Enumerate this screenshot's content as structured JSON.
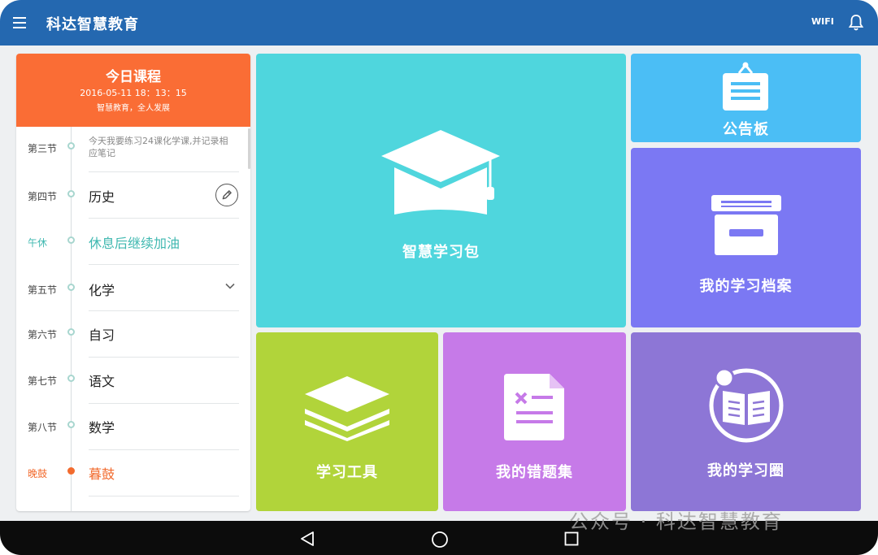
{
  "app": {
    "title": "科达智慧教育",
    "wifi_label": "WIFI"
  },
  "schedule": {
    "header_title": "今日课程",
    "datetime": "2016-05-11 18：13：15",
    "motto": "智慧教育，全人发展",
    "top_note": "今天我要练习24课化学课,并记录相应笔记",
    "rows": [
      {
        "period": "第三节",
        "subject": ""
      },
      {
        "period": "第四节",
        "subject": "历史"
      },
      {
        "period": "午休",
        "subject": "休息后继续加油"
      },
      {
        "period": "第五节",
        "subject": "化学"
      },
      {
        "period": "第六节",
        "subject": "自习"
      },
      {
        "period": "第七节",
        "subject": "语文"
      },
      {
        "period": "第八节",
        "subject": "数学"
      },
      {
        "period": "晚鼓",
        "subject": "暮鼓"
      }
    ]
  },
  "tiles": {
    "study_pack": {
      "label": "智慧学习包",
      "color": "#4fd6dd"
    },
    "bulletin": {
      "label": "公告板",
      "color": "#4bbef5"
    },
    "archive": {
      "label": "我的学习档案",
      "color": "#7b78f3"
    },
    "tools": {
      "label": "学习工具",
      "color": "#b1d43a"
    },
    "mistakes": {
      "label": "我的错题集",
      "color": "#c67ae8"
    },
    "circle": {
      "label": "我的学习圈",
      "color": "#8d76d6"
    }
  },
  "icons": {
    "menu": "hamburger-icon",
    "bell": "bell-icon",
    "edit": "pencil-icon",
    "expand": "chevron-down-icon",
    "back": "triangle-back-icon",
    "home": "circle-home-icon",
    "recents": "square-recents-icon"
  },
  "watermark": "公众号 · 科达智慧教育"
}
